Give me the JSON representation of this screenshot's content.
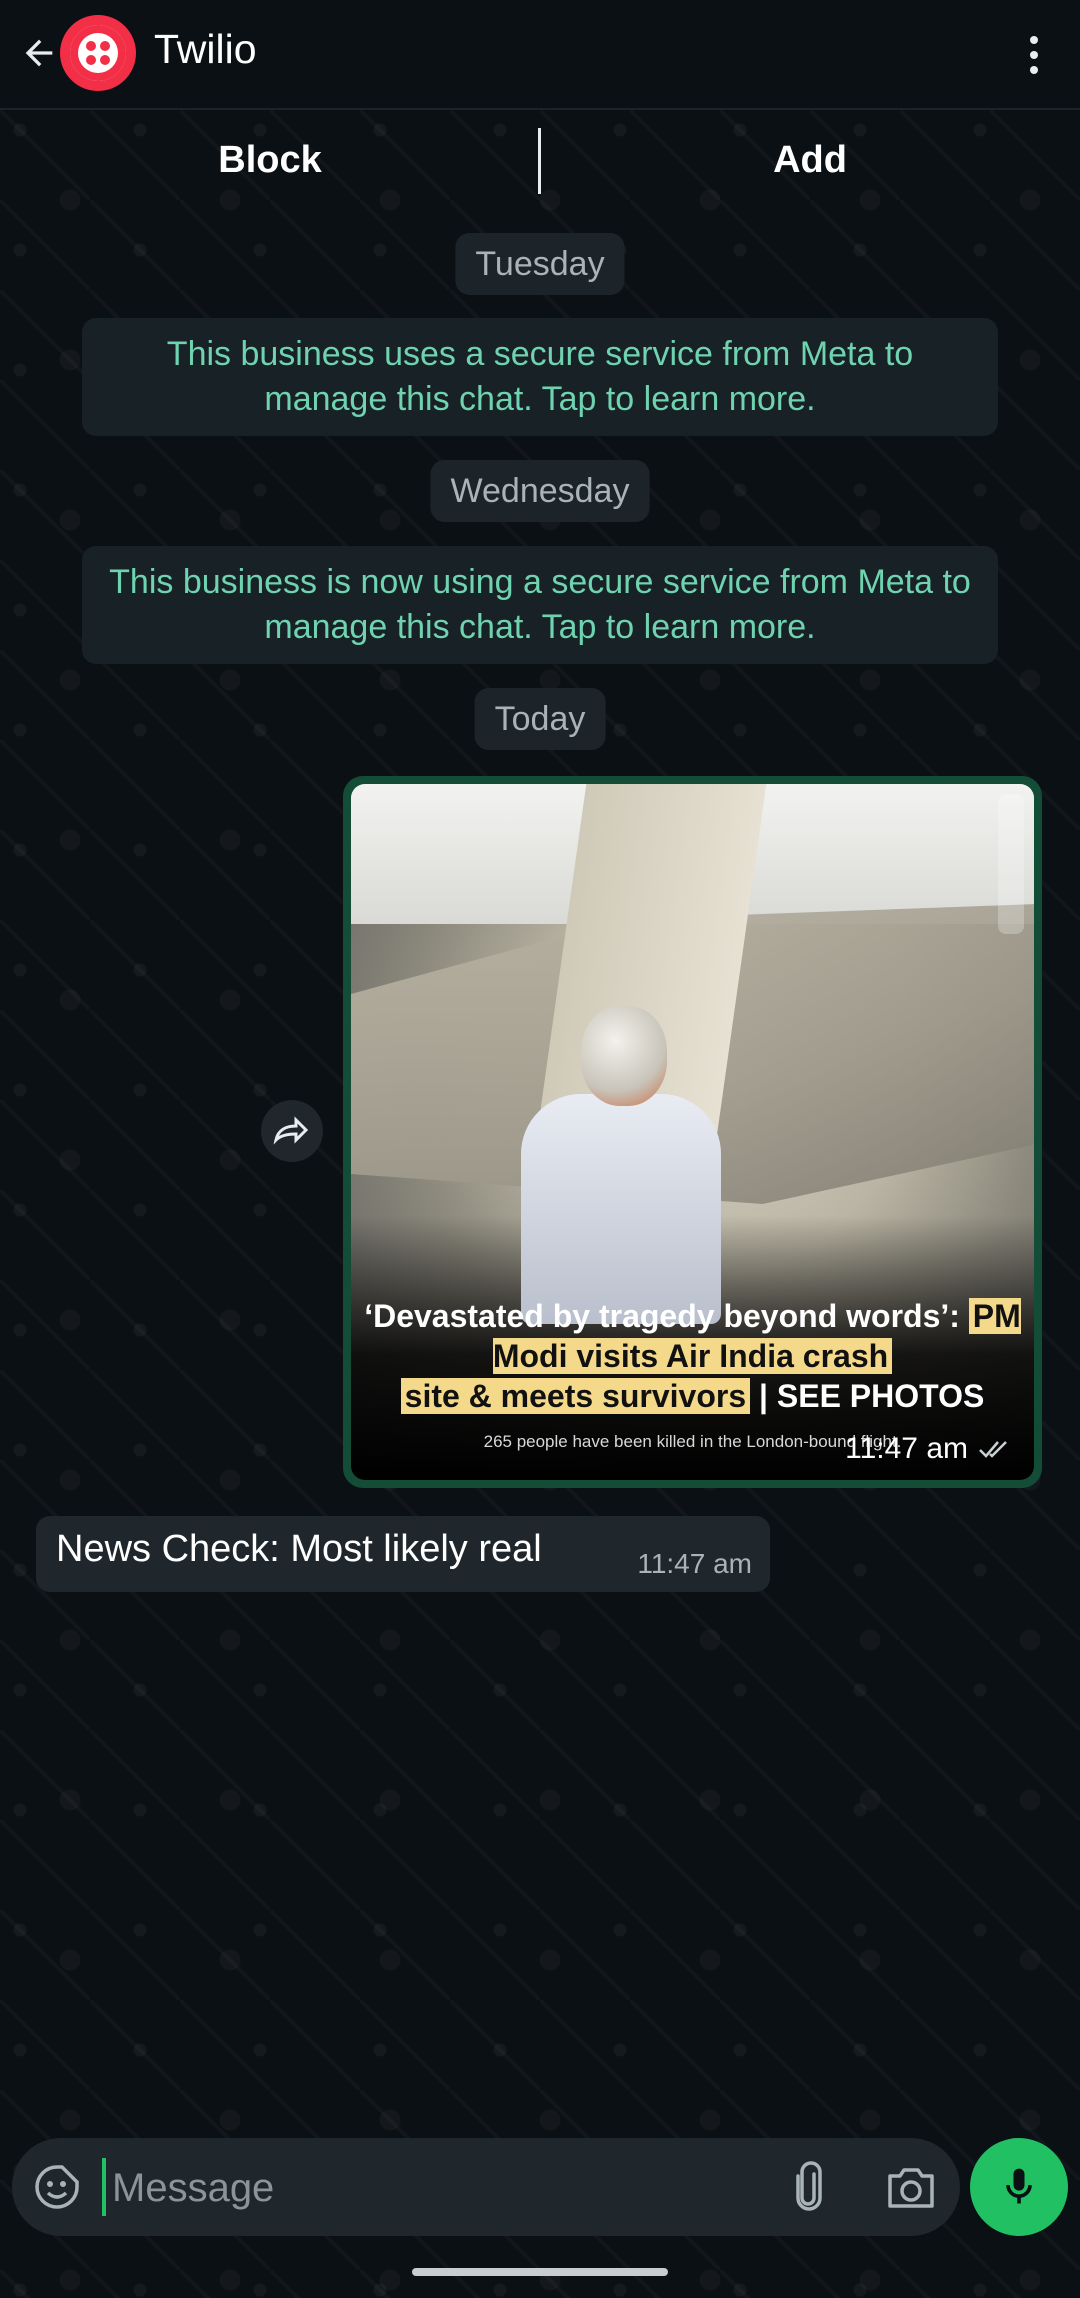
{
  "header": {
    "title": "Twilio",
    "back_icon": "arrow-left-icon",
    "avatar_icon": "twilio-logo-icon",
    "menu_icon": "more-vert-icon",
    "avatar_color": "#f22f46"
  },
  "actions": {
    "block_label": "Block",
    "add_label": "Add"
  },
  "chat": {
    "date_tuesday": "Tuesday",
    "notice_1": "This business uses a secure service from Meta to manage this chat. Tap to learn more.",
    "date_wednesday": "Wednesday",
    "notice_2": "This business is now using a secure service from Meta to manage this chat. Tap to learn more.",
    "date_today": "Today",
    "image_message": {
      "headline_part1": "‘Devastated by tragedy beyond words’:",
      "headline_highlight1": "PM Modi visits Air India crash",
      "headline_highlight2": "site & meets survivors",
      "headline_part2": "| SEE PHOTOS",
      "subline": "265 people have been killed in the London-bound flight.",
      "time": "11:47 am",
      "status_icon": "double-check-icon"
    },
    "forward_icon": "forward-icon",
    "reply_message": {
      "text": "News Check: Most likely real",
      "time": "11:47 am"
    }
  },
  "composer": {
    "placeholder": "Message",
    "emoji_icon": "sticker-emoji-icon",
    "attach_icon": "paperclip-icon",
    "camera_icon": "camera-icon",
    "mic_icon": "microphone-icon",
    "accent_color": "#21c063"
  }
}
